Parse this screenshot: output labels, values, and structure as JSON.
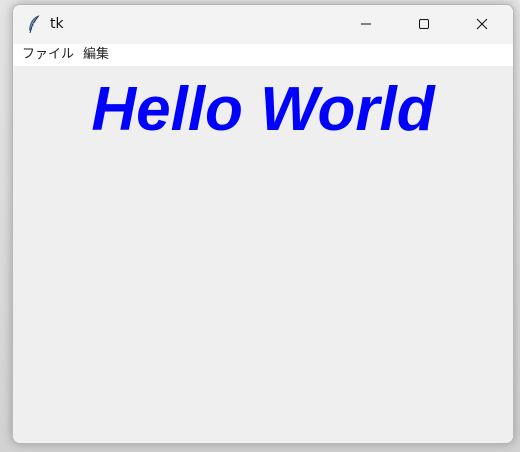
{
  "window": {
    "title": "tk",
    "app_icon": "feather-icon",
    "controls": {
      "minimize_icon": "minimize-icon",
      "maximize_icon": "maximize-icon",
      "close_icon": "close-icon"
    }
  },
  "menubar": {
    "items": [
      {
        "label": "ファイル"
      },
      {
        "label": "編集"
      }
    ]
  },
  "content": {
    "heading": "Hello World",
    "heading_color": "#0000ff"
  }
}
